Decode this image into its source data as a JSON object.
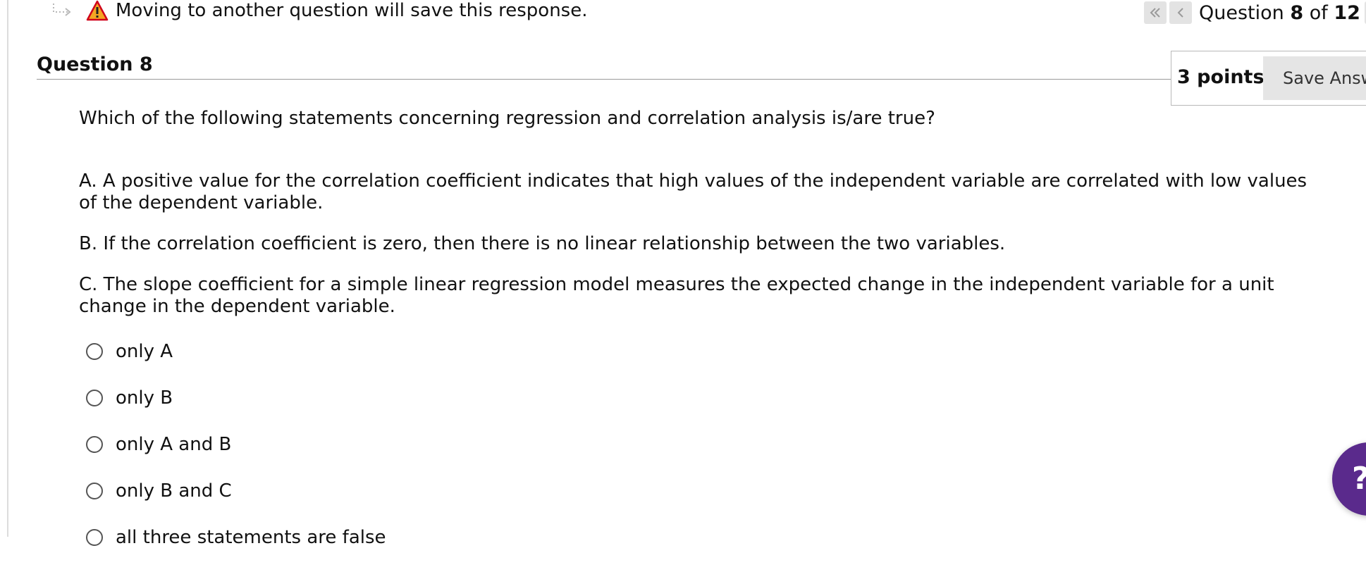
{
  "warning": {
    "text": "Moving to another question will save this response."
  },
  "pager": {
    "prefix": "Question",
    "current": "8",
    "of": "of",
    "total": "12"
  },
  "question": {
    "title": "Question 8",
    "points": "3 points",
    "save_label": "Save Answer",
    "prompt": "Which of the following statements concerning regression and correlation analysis is/are true?",
    "statements": [
      "A. A positive value for the correlation coefficient indicates that high values of the independent variable are correlated with low values of the dependent variable.",
      "B. If the correlation coefficient is zero, then there is no linear relationship between the two variables.",
      "C. The slope coefficient for a simple linear regression model measures the expected change in the independent variable for a unit change in the dependent variable."
    ],
    "choices": [
      "only A",
      "only B",
      "only A and B",
      "only B and C",
      "all three statements are false"
    ]
  },
  "help": {
    "glyph": "?"
  },
  "colors": {
    "help_bubble": "#5a2a8c",
    "warning_icon_fill": "#f5a623",
    "warning_icon_border": "#d0021b"
  },
  "icons": {
    "arrow_hint": "dotted-arrow-icon",
    "warning": "warning-triangle-icon",
    "first": "double-chevron-left-icon",
    "prev": "chevron-left-icon",
    "next": "chevron-right-icon",
    "help": "help-icon"
  }
}
